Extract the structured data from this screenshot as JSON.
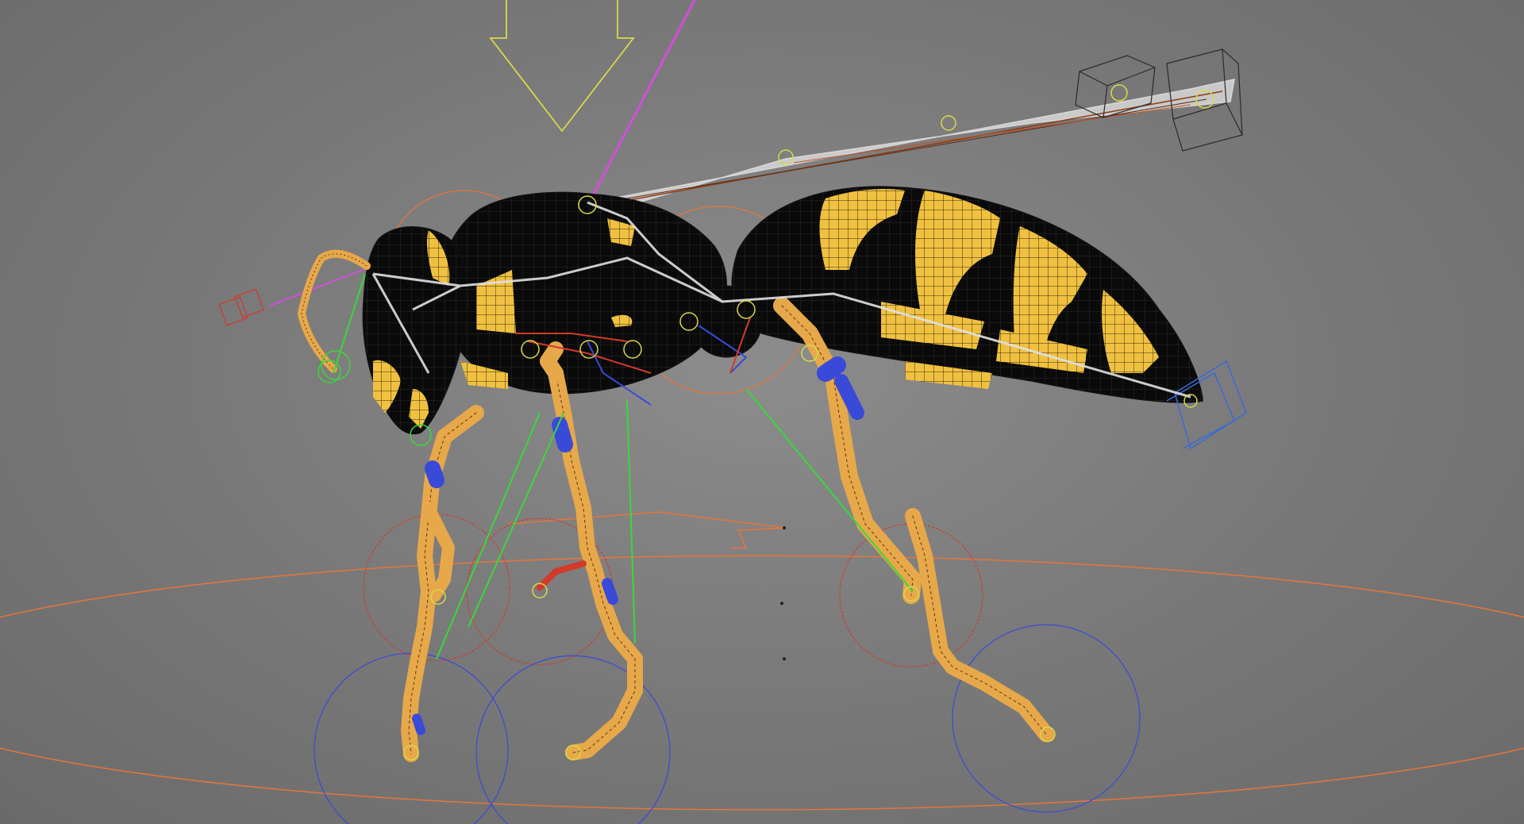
{
  "viewport": {
    "description_label": "",
    "background_color": "#7d7d7d"
  },
  "colors": {
    "body_black": "#0a0a0a",
    "stripe_yellow": "#f0c140",
    "leg_orange": "#e7a84a",
    "wire_dark": "#3a2a10",
    "rig_orange": "#e8753a",
    "rig_red": "#d23a2a",
    "rig_blue": "#3a4ad8",
    "rig_green": "#3ad83a",
    "rig_magenta": "#d050d8",
    "rig_yellow": "#d8d84a",
    "wing_white": "#e8e8e8",
    "box_outline": "#2a2a2a"
  },
  "scene": {
    "object": "wasp-rig",
    "controls": [
      "body-control",
      "head-control",
      "thorax-control",
      "wing-control",
      "stinger-control",
      "leg-ik-controls",
      "ground-control"
    ]
  }
}
